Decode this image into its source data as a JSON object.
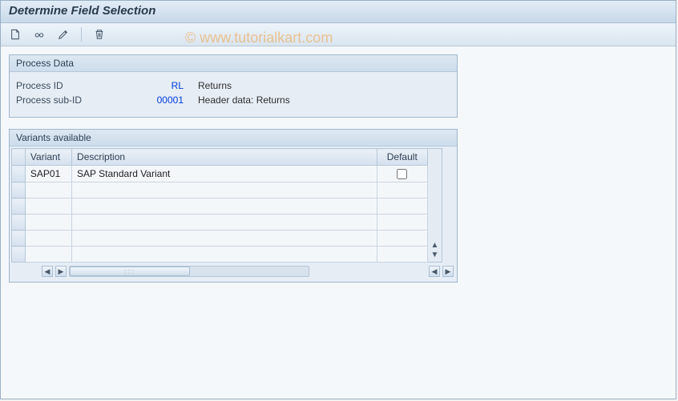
{
  "window": {
    "title": "Determine Field Selection"
  },
  "watermark": "© www.tutorialkart.com",
  "toolbar": {
    "create": "Create",
    "display": "Display",
    "change": "Change",
    "delete": "Delete"
  },
  "process_data": {
    "header": "Process Data",
    "rows": [
      {
        "label": "Process ID",
        "value": "RL",
        "desc": "Returns"
      },
      {
        "label": "Process sub-ID",
        "value": "00001",
        "desc": "Header data: Returns"
      }
    ]
  },
  "variants": {
    "header": "Variants available",
    "columns": {
      "variant": "Variant",
      "description": "Description",
      "default": "Default"
    },
    "rows": [
      {
        "variant": "SAP01",
        "description": "SAP Standard Variant",
        "default": false
      },
      {
        "variant": "",
        "description": "",
        "default": null
      },
      {
        "variant": "",
        "description": "",
        "default": null
      },
      {
        "variant": "",
        "description": "",
        "default": null
      },
      {
        "variant": "",
        "description": "",
        "default": null
      },
      {
        "variant": "",
        "description": "",
        "default": null
      }
    ]
  }
}
